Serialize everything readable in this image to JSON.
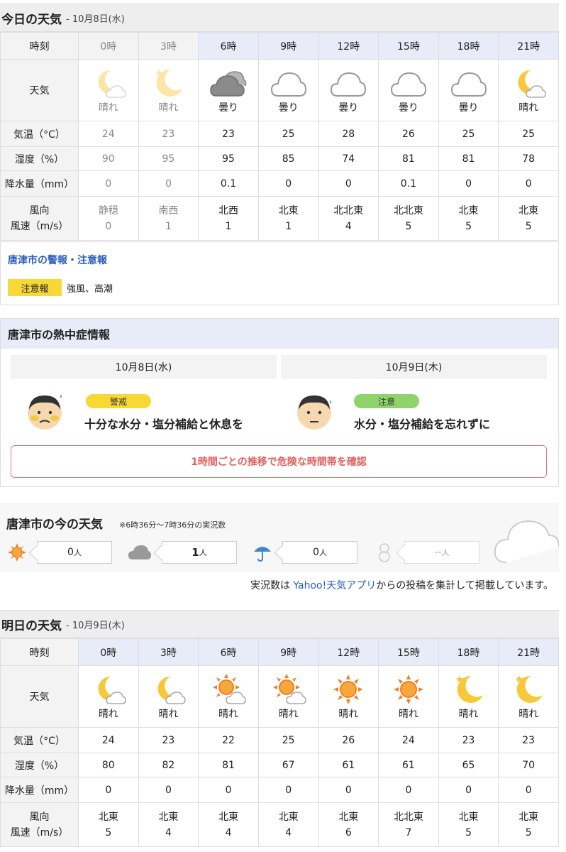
{
  "today": {
    "title": "今日の天気",
    "date": "- 10月8日(水)",
    "labels": {
      "time": "時刻",
      "weather": "天気",
      "temp": "気温（°C）",
      "humidity": "湿度（%）",
      "precip": "降水量（mm）",
      "wind_dir": "風向",
      "wind_speed": "風速（m/s）"
    },
    "hours": [
      "0時",
      "3時",
      "6時",
      "9時",
      "12時",
      "15時",
      "18時",
      "21時"
    ],
    "icons": [
      "moon-cloud-icon",
      "moon-star-icon",
      "dark-cloud-icon",
      "cloud-icon",
      "cloud-icon",
      "cloud-icon",
      "cloud-icon",
      "moon-cloud-icon"
    ],
    "conditions": [
      "晴れ",
      "晴れ",
      "曇り",
      "曇り",
      "曇り",
      "曇り",
      "曇り",
      "晴れ"
    ],
    "temps": [
      "24",
      "23",
      "23",
      "25",
      "28",
      "26",
      "25",
      "25"
    ],
    "humidity": [
      "90",
      "95",
      "95",
      "85",
      "74",
      "81",
      "81",
      "78"
    ],
    "precip": [
      "0",
      "0",
      "0.1",
      "0",
      "0",
      "0.1",
      "0",
      "0"
    ],
    "wind_dir": [
      "静穏",
      "南西",
      "北西",
      "北東",
      "北北東",
      "北北東",
      "北東",
      "北東"
    ],
    "wind_speed": [
      "0",
      "1",
      "1",
      "1",
      "4",
      "5",
      "5",
      "5"
    ]
  },
  "alert": {
    "title": "唐津市の警報・注意報",
    "badge": "注意報",
    "items": "強風、高潮"
  },
  "heat": {
    "title": "唐津市の熱中症情報",
    "days": [
      {
        "date": "10月8日(水)",
        "level": "警戒",
        "level_color": "#f7d835",
        "message": "十分な水分・塩分補給と休息を"
      },
      {
        "date": "10月9日(木)",
        "level": "注意",
        "level_color": "#8fd36a",
        "message": "水分・塩分補給を忘れずに"
      }
    ],
    "link": "1時間ごとの推移で危険な時間帯を確認"
  },
  "now": {
    "title": "唐津市の今の天気",
    "note": "※6時36分〜7時36分の実況数",
    "counts": [
      {
        "icon": "sun-icon",
        "value": "0",
        "unit": "人"
      },
      {
        "icon": "cloud-icon",
        "value": "1",
        "unit": "人"
      },
      {
        "icon": "umbrella-icon",
        "value": "0",
        "unit": "人"
      },
      {
        "icon": "snowman-icon",
        "value": "--",
        "unit": "人"
      }
    ],
    "footer_pre": "実況数は ",
    "footer_link": "Yahoo!天気アプリ",
    "footer_post": "からの投稿を集計して掲載しています。"
  },
  "tomorrow": {
    "title": "明日の天気",
    "date": "- 10月9日(木)",
    "labels": {
      "time": "時刻",
      "weather": "天気",
      "temp": "気温（°C）",
      "humidity": "湿度（%）",
      "precip": "降水量（mm）",
      "wind_dir": "風向",
      "wind_speed": "風速（m/s）"
    },
    "hours": [
      "0時",
      "3時",
      "6時",
      "9時",
      "12時",
      "15時",
      "18時",
      "21時"
    ],
    "icons": [
      "moon-cloud-icon",
      "moon-cloud-icon",
      "sun-cloud-icon",
      "sun-cloud-icon",
      "sun-icon",
      "sun-icon",
      "moon-star-icon",
      "moon-star-icon"
    ],
    "conditions": [
      "晴れ",
      "晴れ",
      "晴れ",
      "晴れ",
      "晴れ",
      "晴れ",
      "晴れ",
      "晴れ"
    ],
    "temps": [
      "24",
      "23",
      "22",
      "25",
      "26",
      "24",
      "23",
      "23"
    ],
    "humidity": [
      "80",
      "82",
      "81",
      "67",
      "61",
      "61",
      "65",
      "70"
    ],
    "precip": [
      "0",
      "0",
      "0",
      "0",
      "0",
      "0",
      "0",
      "0"
    ],
    "wind_dir": [
      "北東",
      "北東",
      "北東",
      "北東",
      "北東",
      "北北東",
      "北東",
      "北東"
    ],
    "wind_speed": [
      "5",
      "4",
      "4",
      "4",
      "6",
      "7",
      "5",
      "5"
    ]
  }
}
